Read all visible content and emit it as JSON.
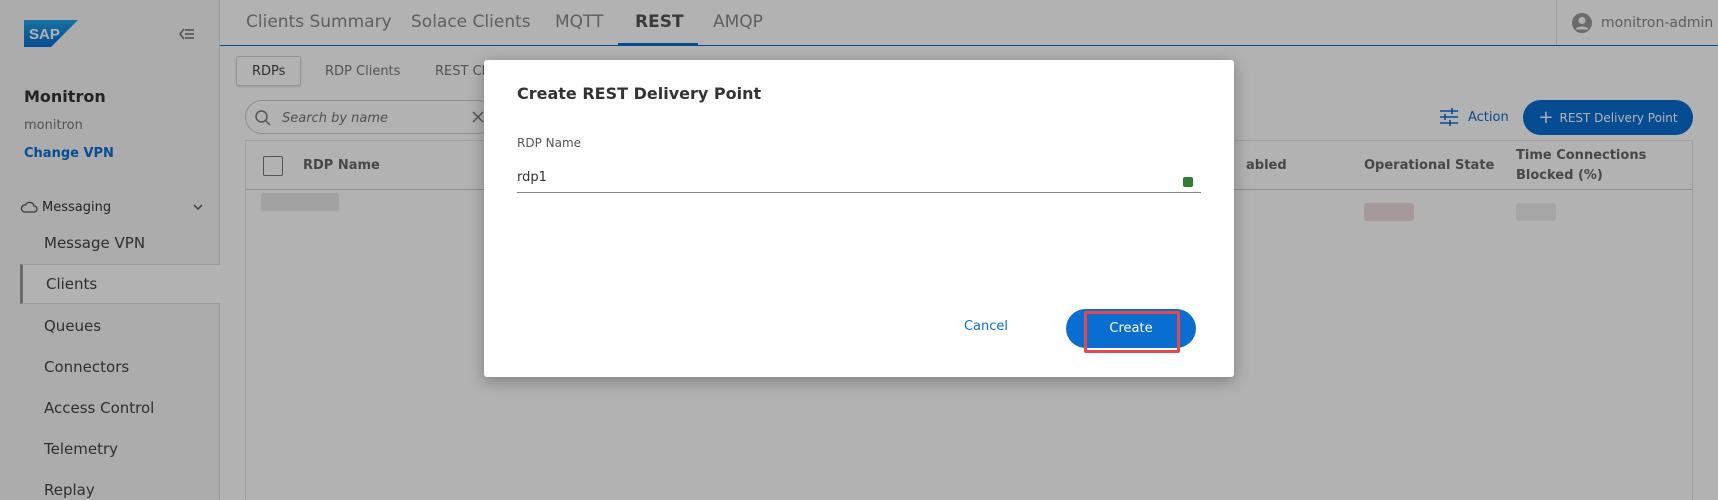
{
  "brand": {
    "logo_text": "SAP"
  },
  "sidebar": {
    "org_name": "Monitron",
    "org_sub": "monitron",
    "change_vpn": "Change VPN",
    "section_label": "Messaging",
    "items": [
      {
        "label": "Message VPN"
      },
      {
        "label": "Clients"
      },
      {
        "label": "Queues"
      },
      {
        "label": "Connectors"
      },
      {
        "label": "Access Control"
      },
      {
        "label": "Telemetry"
      },
      {
        "label": "Replay"
      }
    ]
  },
  "top_tabs": [
    {
      "label": "Clients Summary"
    },
    {
      "label": "Solace Clients"
    },
    {
      "label": "MQTT"
    },
    {
      "label": "REST"
    },
    {
      "label": "AMQP"
    }
  ],
  "active_top_tab": "REST",
  "user": {
    "name": "monitron-admin"
  },
  "sub_tabs": [
    {
      "label": "RDPs"
    },
    {
      "label": "RDP Clients"
    },
    {
      "label": "REST Cli"
    }
  ],
  "search": {
    "placeholder": "Search by name"
  },
  "toolbar": {
    "action_label": "Action",
    "create_label": "REST Delivery Point"
  },
  "table": {
    "columns": {
      "name": "RDP Name",
      "enabled": "abled",
      "operational_state": "Operational State",
      "time_blocked_line1": "Time Connections",
      "time_blocked_line2": "Blocked (%)"
    }
  },
  "dialog": {
    "title": "Create REST Delivery Point",
    "field_label": "RDP Name",
    "field_value": "rdp1",
    "cancel_label": "Cancel",
    "create_label": "Create"
  },
  "colors": {
    "accent": "#0a6ed1",
    "highlight": "#e5484d",
    "valid_indicator": "#2e7d32"
  }
}
